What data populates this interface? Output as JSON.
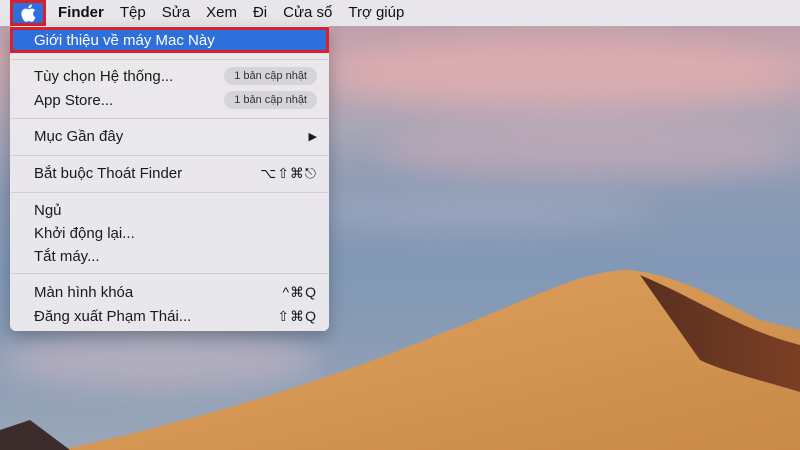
{
  "menubar": {
    "apple_icon": "apple-logo-icon",
    "items": [
      "Finder",
      "Tệp",
      "Sửa",
      "Xem",
      "Đi",
      "Cửa sổ",
      "Trợ giúp"
    ]
  },
  "apple_menu": {
    "highlight_color": "#2f6fdc",
    "annotation_border_color": "#d9212b",
    "about": "Giới thiệu về máy Mac Này",
    "system_prefs": {
      "label": "Tùy chọn Hệ thống...",
      "badge": "1 bản cập nhật"
    },
    "app_store": {
      "label": "App Store...",
      "badge": "1 bản cập nhật"
    },
    "recent_items": {
      "label": "Mục Gần đây",
      "submenu_icon": "triangle-right-icon"
    },
    "force_quit": {
      "label": "Bắt buộc Thoát Finder",
      "shortcut": "⌥⇧⌘⎋"
    },
    "sleep": "Ngủ",
    "restart": "Khởi động lại...",
    "shutdown": "Tắt máy...",
    "lock_screen": {
      "label": "Màn hình khóa",
      "shortcut": "^⌘Q"
    },
    "logout": {
      "label": "Đăng xuất Phạm Thái...",
      "shortcut": "⇧⌘Q"
    }
  }
}
